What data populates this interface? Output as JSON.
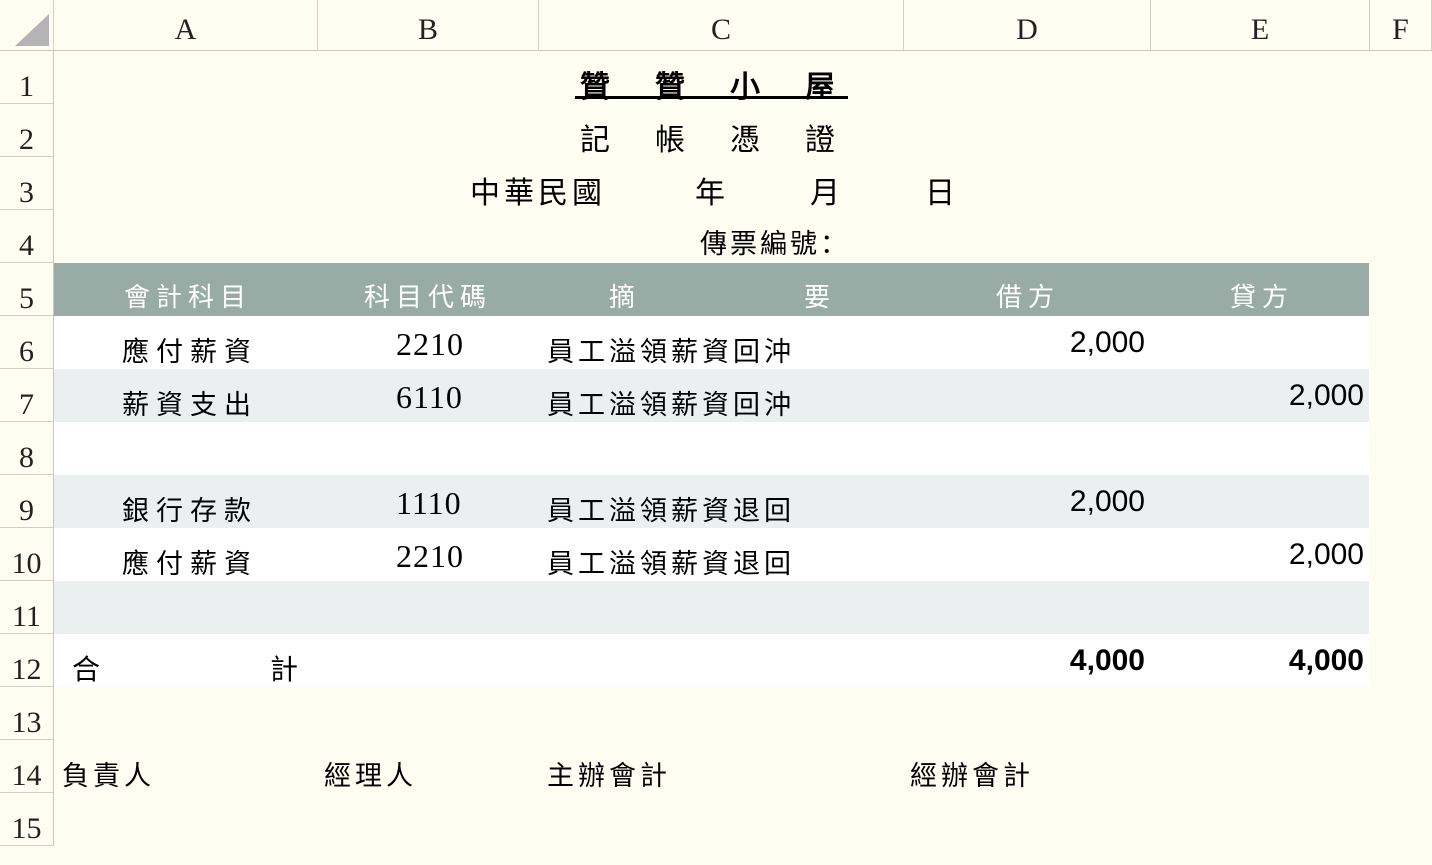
{
  "columns": [
    "A",
    "B",
    "C",
    "D",
    "E",
    "F"
  ],
  "rows": [
    "1",
    "2",
    "3",
    "4",
    "5",
    "6",
    "7",
    "8",
    "9",
    "10",
    "11",
    "12",
    "13",
    "14",
    "15"
  ],
  "voucher": {
    "title_chars": [
      "贊",
      "贊",
      "小",
      "屋"
    ],
    "subtitle_chars": [
      "記",
      "帳",
      "憑",
      "證"
    ],
    "date_era": "中華民國",
    "date_year": "年",
    "date_month": "月",
    "date_day": "日",
    "voucher_no_label": "傳票編號："
  },
  "table": {
    "headers": {
      "account": "會計科目",
      "code": "科目代碼",
      "summary_left": "摘",
      "summary_right": "要",
      "debit": "借方",
      "credit": "貸方"
    },
    "entries": [
      {
        "account": "應付薪資",
        "code": "2210",
        "summary": "員工溢領薪資回沖",
        "debit": "2,000",
        "credit": ""
      },
      {
        "account": "薪資支出",
        "code": "6110",
        "summary": "員工溢領薪資回沖",
        "debit": "",
        "credit": "2,000"
      },
      {
        "account": "",
        "code": "",
        "summary": "",
        "debit": "",
        "credit": ""
      },
      {
        "account": "銀行存款",
        "code": "1110",
        "summary": "員工溢領薪資退回",
        "debit": "2,000",
        "credit": ""
      },
      {
        "account": "應付薪資",
        "code": "2210",
        "summary": "員工溢領薪資退回",
        "debit": "",
        "credit": "2,000"
      },
      {
        "account": "",
        "code": "",
        "summary": "",
        "debit": "",
        "credit": ""
      }
    ],
    "total": {
      "label_left": "合",
      "label_right": "計",
      "debit": "4,000",
      "credit": "4,000"
    }
  },
  "signatures": [
    "負責人",
    "經理人",
    "主辦會計",
    "經辦會計"
  ]
}
